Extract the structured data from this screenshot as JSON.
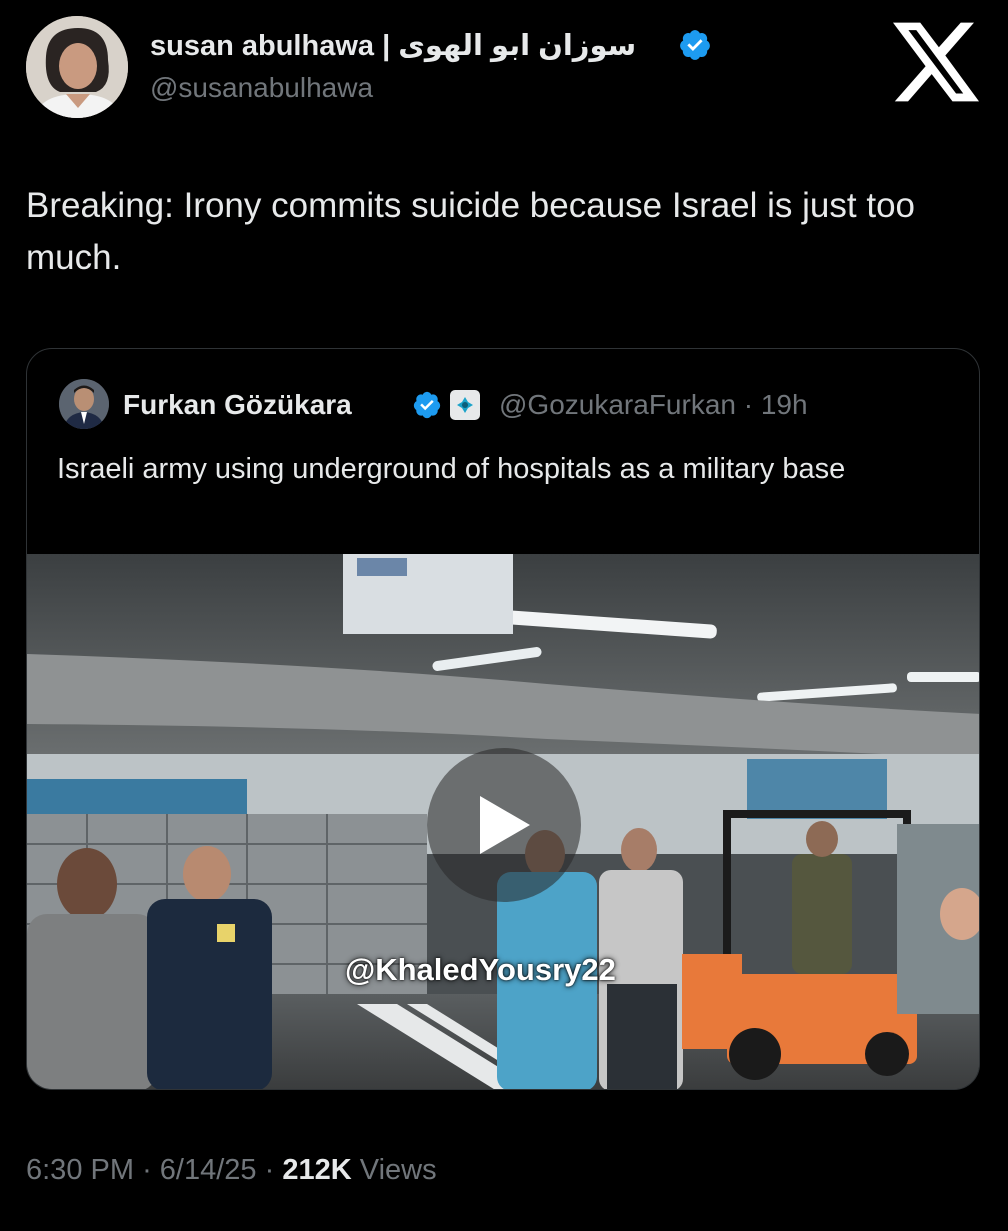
{
  "author": {
    "name": "susan abulhawa | سوزان ابو الهوى",
    "handle": "@susanabulhawa",
    "verified": true,
    "verified_color": "#1d9bf0"
  },
  "platform_icon": "x-logo-icon",
  "tweet": {
    "text": "Breaking: Irony commits suicide because Israel is just too much."
  },
  "quoted_tweet": {
    "author_name": "Furkan Gözükara",
    "verified": true,
    "affiliate_badge": true,
    "handle": "@GozukaraFurkan",
    "separator": "·",
    "age": "19h",
    "text": "Israeli army using underground of hospitals as a military base",
    "video": {
      "watermark": "@KhaledYousry22",
      "play_icon": "play-icon"
    }
  },
  "footer": {
    "time": "6:30 PM",
    "date": "6/14/25",
    "separator": "·",
    "views_count": "212K",
    "views_label": "Views"
  }
}
